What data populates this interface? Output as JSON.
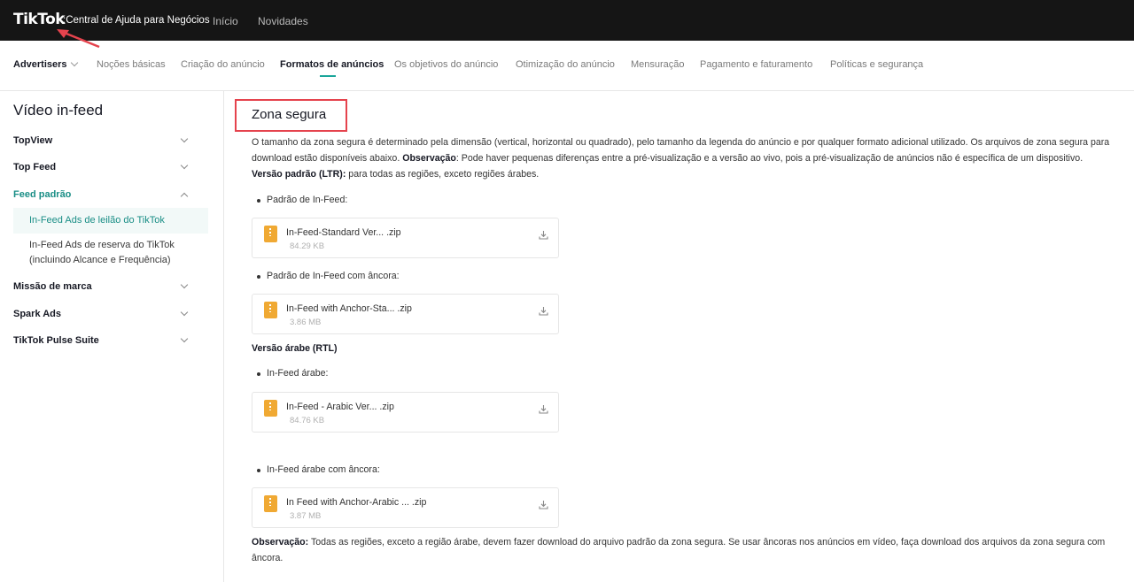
{
  "header": {
    "logo": "TikTok",
    "subtitle": ":Central de Ajuda para Negócios",
    "links": [
      "Início",
      "Novidades"
    ]
  },
  "nav": {
    "items": [
      "Advertisers",
      "Noções básicas",
      "Criação do anúncio",
      "Formatos de anúncios",
      "Os objetivos do anúncio",
      "Otimização do anúncio",
      "Mensuração",
      "Pagamento e faturamento",
      "Políticas e segurança"
    ],
    "active": "Formatos de anúncios"
  },
  "sidebar": {
    "title": "Vídeo in-feed",
    "items": [
      {
        "label": "TopView"
      },
      {
        "label": "Top Feed"
      },
      {
        "label": "Feed padrão"
      },
      {
        "label": "Missão de marca"
      },
      {
        "label": "Spark Ads"
      },
      {
        "label": "TikTok Pulse Suite"
      }
    ],
    "subitems": [
      {
        "label": "In-Feed Ads de leilão do TikTok"
      },
      {
        "label": "In-Feed Ads de reserva do TikTok (incluindo Alcance e Frequência)"
      }
    ]
  },
  "main": {
    "title": "Zona segura",
    "intro_1": "O tamanho da zona segura é determinado pela dimensão (vertical, horizontal ou quadrado), pelo tamanho da legenda do anúncio e por qualquer formato adicional utilizado. Os arquivos de zona segura para download estão disponíveis abaixo.",
    "obs_label": "Observação",
    "intro_2": ": Pode haver pequenas diferenças entre a pré-visualização e a versão ao vivo, pois a pré-visualização de anúncios não é específica de um dispositivo.",
    "ltr_label": "Versão padrão (LTR):",
    "ltr_text": " para todas as regiões, exceto regiões árabes.",
    "rtl_heading": "Versão árabe (RTL)",
    "files": [
      {
        "bullet": "Padrão de In-Feed:",
        "name": "In-Feed-Standard Ver... .zip",
        "size": "84.29 KB"
      },
      {
        "bullet": "Padrão de In-Feed com âncora:",
        "name": "In-Feed with Anchor-Sta... .zip",
        "size": "3.86 MB"
      },
      {
        "bullet": "In-Feed árabe:",
        "name": "In-Feed - Arabic Ver... .zip",
        "size": "84.76 KB"
      },
      {
        "bullet": "In-Feed árabe com âncora:",
        "name": "In Feed with Anchor-Arabic ... .zip",
        "size": "3.87 MB"
      }
    ],
    "footer_label": "Observação:",
    "footer_text": " Todas as regiões, exceto a região árabe, devem fazer download do arquivo padrão da zona segura. Se usar âncoras nos anúncios em vídeo, faça download dos arquivos da zona segura com âncora."
  },
  "colors": {
    "accent": "#1aa59a",
    "highlight": "#e5434d",
    "file_icon": "#f0a933"
  }
}
